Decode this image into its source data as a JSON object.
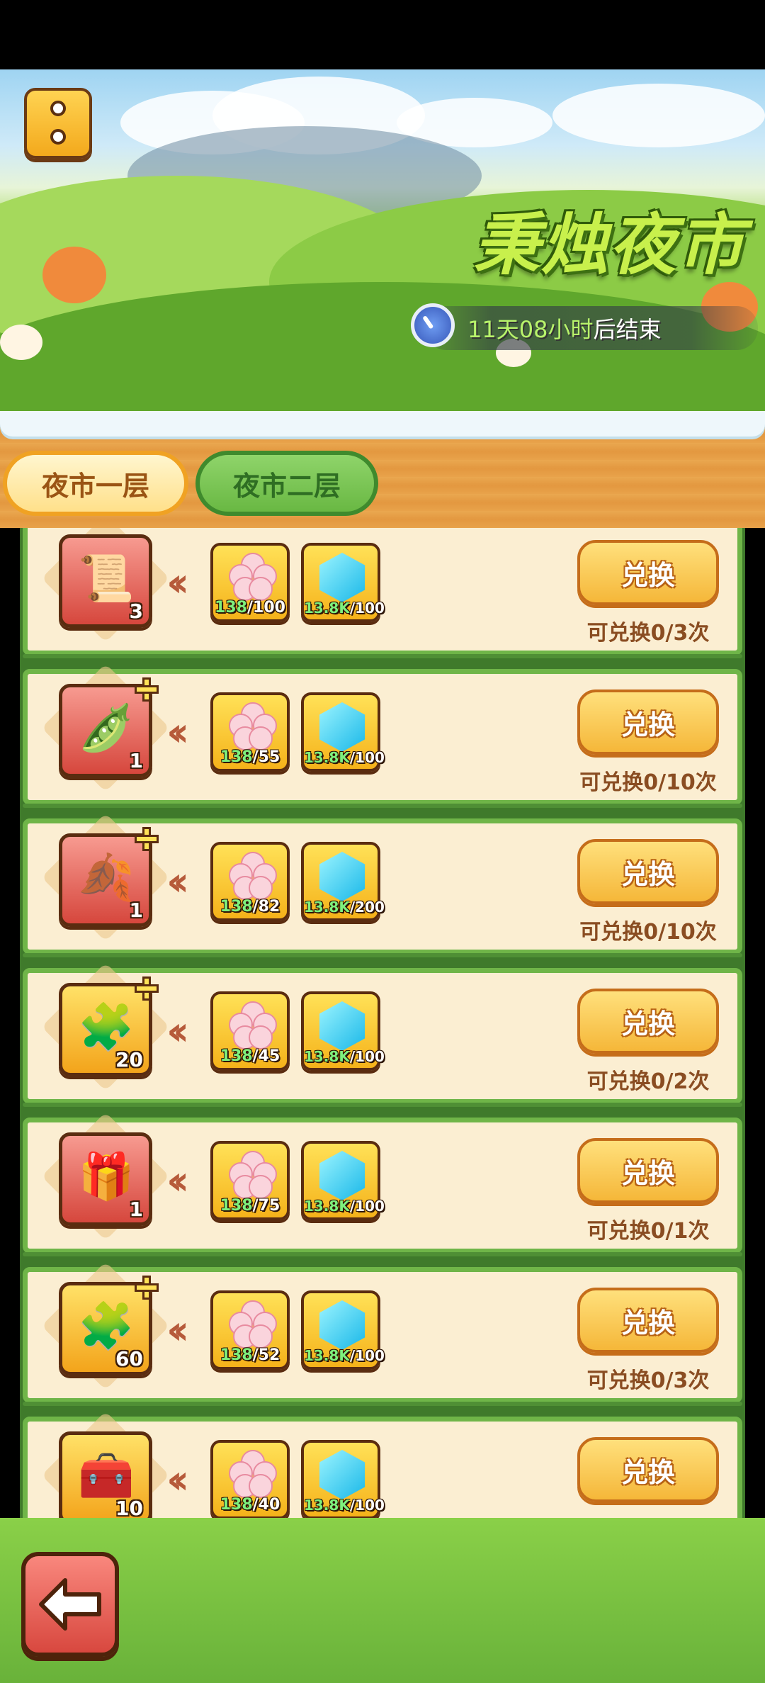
{
  "banner": {
    "title": "秉烛夜市",
    "timer_prefix": "11天08小时",
    "timer_suffix": "后结束"
  },
  "tabs": [
    {
      "label": "夜市一层",
      "active": true
    },
    {
      "label": "夜市二层",
      "active": false
    }
  ],
  "rows": [
    {
      "item_icon": "scroll-icon",
      "item_count": "3",
      "flower_have": "138",
      "flower_need": "/100",
      "gem_have": "13.8K",
      "gem_need": "/100",
      "button": "兑换",
      "limit": "可兑换0/3次"
    },
    {
      "item_icon": "pod-icon",
      "item_count": "1",
      "flower_have": "138",
      "flower_need": "/55",
      "gem_have": "13.8K",
      "gem_need": "/100",
      "button": "兑换",
      "limit": "可兑换0/10次"
    },
    {
      "item_icon": "amber-shard-icon",
      "item_count": "1",
      "flower_have": "138",
      "flower_need": "/82",
      "gem_have": "13.8K",
      "gem_need": "/200",
      "button": "兑换",
      "limit": "可兑换0/10次"
    },
    {
      "item_icon": "puzzle-gold-icon",
      "item_count": "20",
      "flower_have": "138",
      "flower_need": "/45",
      "gem_have": "13.8K",
      "gem_need": "/100",
      "button": "兑换",
      "limit": "可兑换0/2次"
    },
    {
      "item_icon": "chest-icon",
      "item_count": "1",
      "flower_have": "138",
      "flower_need": "/75",
      "gem_have": "13.8K",
      "gem_need": "/100",
      "button": "兑换",
      "limit": "可兑换0/1次"
    },
    {
      "item_icon": "puzzle-token-icon",
      "item_count": "60",
      "flower_have": "138",
      "flower_need": "/52",
      "gem_have": "13.8K",
      "gem_need": "/100",
      "button": "兑换",
      "limit": "可兑换0/3次"
    },
    {
      "item_icon": "iron-chest-icon",
      "item_count": "10",
      "flower_have": "138",
      "flower_need": "/40",
      "gem_have": "13.8K",
      "gem_need": "/100",
      "button": "兑换",
      "limit": ""
    }
  ],
  "colors": {
    "accent_green": "#6fb548",
    "button_gold": "#f5b739",
    "wood": "#e8a24a"
  }
}
